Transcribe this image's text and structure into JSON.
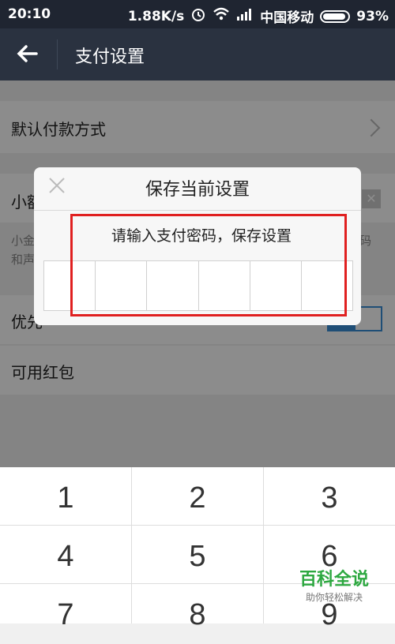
{
  "status_bar": {
    "time": "20:10",
    "speed": "1.88K/s",
    "carrier": "中国移动",
    "battery": "93%"
  },
  "app_bar": {
    "title": "支付设置"
  },
  "rows": {
    "default_payment": "默认付款方式",
    "small_partial": "小額",
    "small_desc_line1": "小金",
    "small_desc_line1_right": "码",
    "small_desc_line2": "和声",
    "priority_partial": "优先",
    "red_packet": "可用红包"
  },
  "dialog": {
    "title": "保存当前设置",
    "prompt": "请输入支付密码，保存设置"
  },
  "keypad": {
    "keys": [
      "1",
      "2",
      "3",
      "4",
      "5",
      "6",
      "7",
      "8",
      "9"
    ]
  },
  "watermark": {
    "brand": "百科全说",
    "tagline": "助你轻松解决"
  },
  "colors": {
    "status_bg": "#1f2531",
    "app_bar_bg": "#2a3240",
    "highlight": "#e02020",
    "accent": "#3a8fd8",
    "watermark": "#2da840"
  },
  "icons": {
    "back": "arrow-left-icon",
    "close": "close-icon",
    "alarm": "alarm-icon",
    "wifi": "wifi-icon",
    "signal": "signal-icon",
    "battery": "battery-icon"
  }
}
